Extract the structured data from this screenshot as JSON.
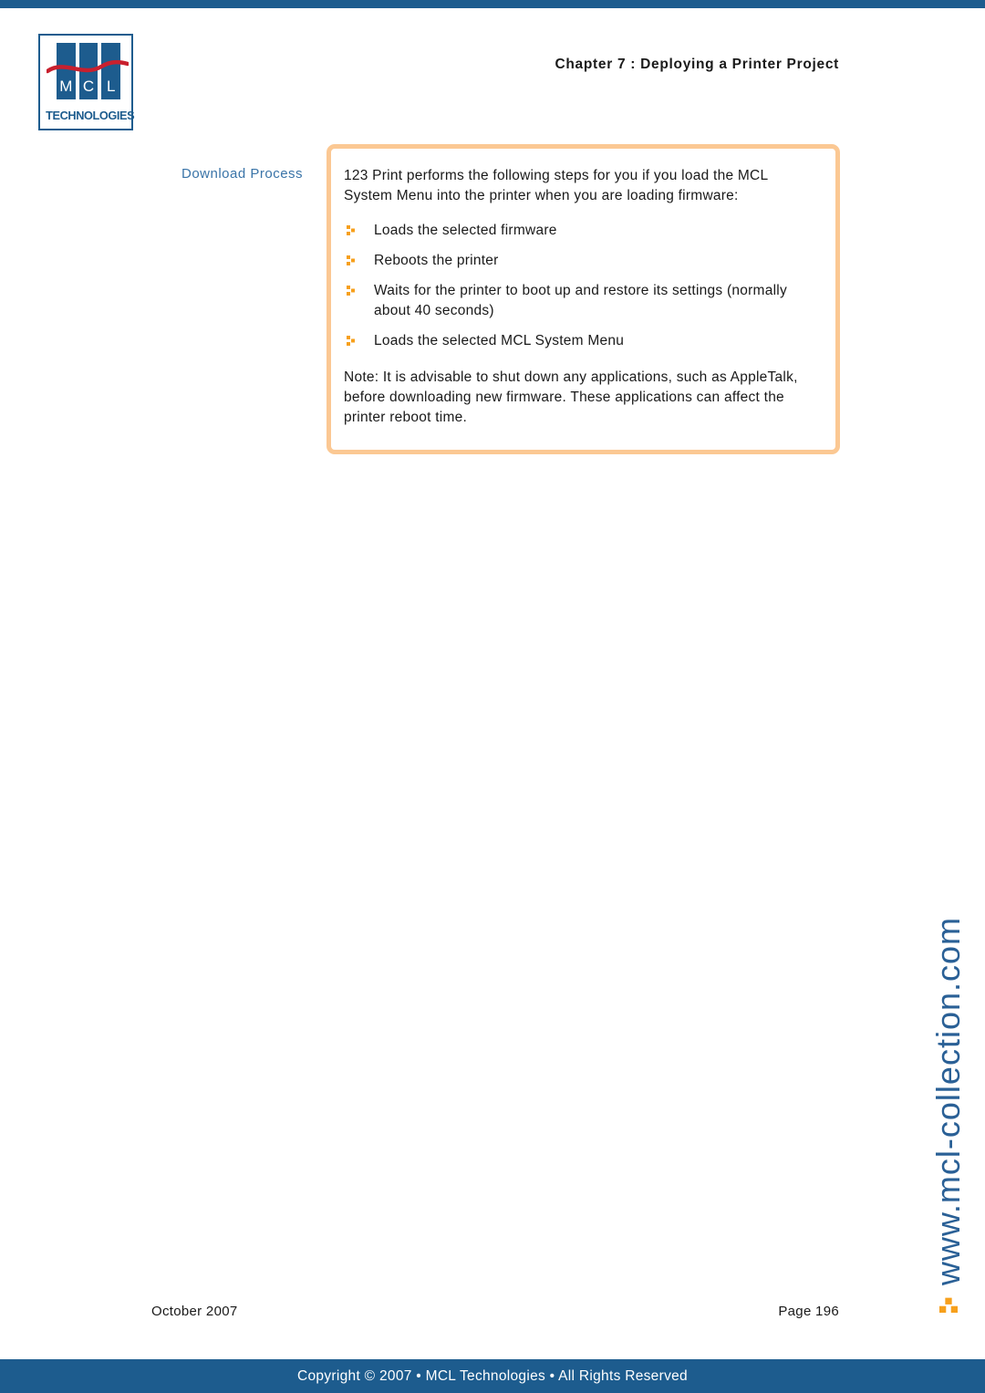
{
  "colors": {
    "brand_blue": "#1D5C8E",
    "label_blue": "#3A74A8",
    "box_border_orange": "#FBC893",
    "bullet_orange": "#F7A01C",
    "watermark_blue": "#2A6096",
    "logo_wave_red": "#C8202E"
  },
  "header": {
    "chapter_title": "Chapter 7 : Deploying a Printer Project"
  },
  "logo": {
    "letters": [
      "M",
      "C",
      "L"
    ],
    "tagline": "TECHNOLOGIES"
  },
  "section": {
    "label": "Download Process"
  },
  "content": {
    "intro": "123 Print performs the following steps for you if you load the MCL System Menu into the printer when you are loading firmware:",
    "steps": [
      "Loads the selected firmware",
      "Reboots the printer",
      "Waits for the printer to boot up and restore its settings (normally about 40 seconds)",
      "Loads the selected MCL System Menu"
    ],
    "note": "Note: It is advisable to shut down any applications, such as AppleTalk, before downloading new firmware. These applications can affect the printer reboot time."
  },
  "watermark": {
    "url": "www.mcl-collection.com"
  },
  "footer": {
    "date": "October 2007",
    "page": "Page 196",
    "copyright": "Copyright © 2007 • MCL Technologies • All Rights Reserved"
  }
}
